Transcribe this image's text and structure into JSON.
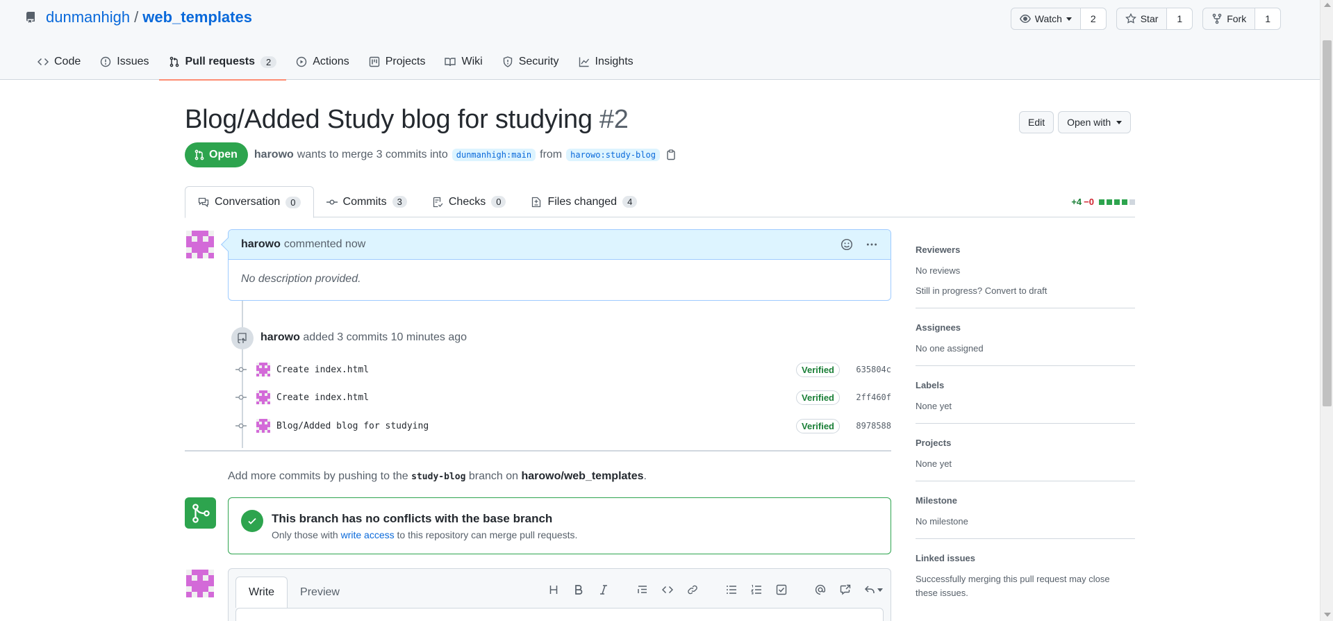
{
  "repo": {
    "owner": "dunmanhigh",
    "separator": "/",
    "name": "web_templates",
    "actions": [
      {
        "label": "Watch",
        "count": "2",
        "icon": "eye-icon"
      },
      {
        "label": "Star",
        "count": "1",
        "icon": "star-icon"
      },
      {
        "label": "Fork",
        "count": "1",
        "icon": "fork-icon"
      }
    ]
  },
  "nav": {
    "items": [
      {
        "label": "Code",
        "icon": "code-icon"
      },
      {
        "label": "Issues",
        "icon": "issue-icon"
      },
      {
        "label": "Pull requests",
        "icon": "pull-request-icon",
        "count": "2",
        "active": true
      },
      {
        "label": "Actions",
        "icon": "play-icon"
      },
      {
        "label": "Projects",
        "icon": "project-icon"
      },
      {
        "label": "Wiki",
        "icon": "book-icon"
      },
      {
        "label": "Security",
        "icon": "shield-icon"
      },
      {
        "label": "Insights",
        "icon": "graph-icon"
      }
    ]
  },
  "pr": {
    "title": "Blog/Added Study blog for studying",
    "number": "#2",
    "edit_label": "Edit",
    "open_with_label": "Open with",
    "state": "Open",
    "author": "harowo",
    "merge_text_1": "wants to merge 3 commits into",
    "base_branch": "dunmanhigh:main",
    "from_text": "from",
    "head_branch": "harowo:study-blog",
    "tabs": [
      {
        "label": "Conversation",
        "count": "0",
        "icon": "comment-icon"
      },
      {
        "label": "Commits",
        "count": "3",
        "icon": "commit-icon"
      },
      {
        "label": "Checks",
        "count": "0",
        "icon": "checklist-icon"
      },
      {
        "label": "Files changed",
        "count": "4",
        "icon": "file-diff-icon"
      }
    ],
    "diffstat": {
      "additions": "+4",
      "deletions": "−0"
    }
  },
  "comment": {
    "author": "harowo",
    "action": "commented now",
    "body": "No description provided."
  },
  "commit_event": {
    "author": "harowo",
    "text": "added 3 commits 10 minutes ago",
    "commits": [
      {
        "message": "Create index.html",
        "status": "Verified",
        "sha": "635804c"
      },
      {
        "message": "Create index.html",
        "status": "Verified",
        "sha": "2ff460f"
      },
      {
        "message": "Blog/Added blog for studying",
        "status": "Verified",
        "sha": "8978588"
      }
    ]
  },
  "push_hint": {
    "prefix": "Add more commits by pushing to the",
    "branch": "study-blog",
    "middle": "branch on",
    "repo": "harowo/web_templates",
    "suffix": "."
  },
  "merge": {
    "title": "This branch has no conflicts with the base branch",
    "sub_prefix": "Only those with",
    "sub_link": "write access",
    "sub_suffix": "to this repository can merge pull requests."
  },
  "editor": {
    "write_label": "Write",
    "preview_label": "Preview"
  },
  "sidebar": {
    "reviewers_title": "Reviewers",
    "reviewers_value": "No reviews",
    "reviewers_extra": "Still in progress? Convert to draft",
    "assignees_title": "Assignees",
    "assignees_value": "No one assigned",
    "labels_title": "Labels",
    "labels_value": "None yet",
    "projects_title": "Projects",
    "projects_value": "None yet",
    "milestone_title": "Milestone",
    "milestone_value": "No milestone",
    "linked_title": "Linked issues",
    "linked_value": "Successfully merging this pull request may close these issues."
  },
  "colors": {
    "accent": "#0969da",
    "open_green": "#2da44e",
    "nav_underline": "#fd8c73",
    "avatar_pink": "#d36ad8"
  }
}
